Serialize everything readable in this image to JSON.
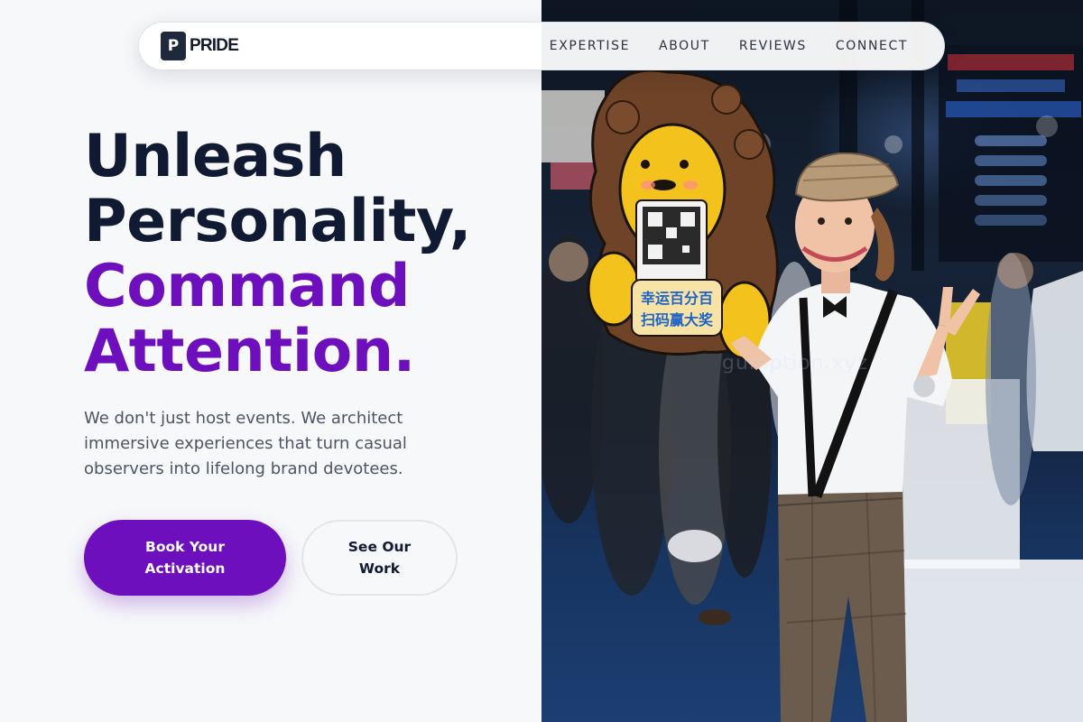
{
  "nav": {
    "brand_mark": "P",
    "brand_name": "PRIDE",
    "links": [
      "EXPERTISE",
      "ABOUT",
      "REVIEWS",
      "CONNECT"
    ]
  },
  "hero": {
    "headline_line1": "Unleash",
    "headline_line2": "Personality,",
    "headline_line3": "Command",
    "headline_line4": "Attention.",
    "subtext": "We don't just host events. We architect immersive experiences that turn casual observers into lifelong brand devotees.",
    "primary_cta_line1": "Book Your",
    "primary_cta_line2": "Activation",
    "secondary_cta_line1": "See Our",
    "secondary_cta_line2": "Work"
  },
  "photo": {
    "sign_text_line1": "幸运百分百",
    "sign_text_line2": "扫码赢大奖",
    "watermark": "gumption.xyz"
  },
  "colors": {
    "accent": "#6d0fbd",
    "heading": "#111a33",
    "body_text": "#4b5563",
    "background": "#f7f8fa"
  }
}
